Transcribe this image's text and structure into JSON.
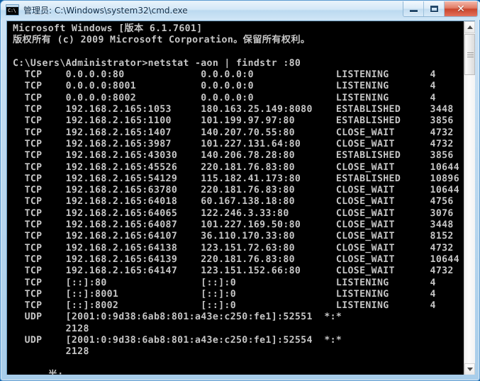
{
  "window": {
    "title": "管理员: C:\\Windows\\system32\\cmd.exe",
    "icon_label": "C:\\",
    "icon_name": "cmd-console-icon",
    "buttons": {
      "minimize": "minimize",
      "maximize": "maximize",
      "close": "✕"
    },
    "frame_color": "#a8cdea",
    "titlebar_color": "#d4e8f7",
    "close_color": "#c9452c"
  },
  "console": {
    "background_color": "#000000",
    "text_color": "#c6c6c6",
    "banner": [
      "Microsoft Windows [版本 6.1.7601]",
      "版权所有 (c) 2009 Microsoft Corporation。保留所有权利。"
    ],
    "prompt": "C:\\Users\\Administrator>",
    "command": "netstat -aon | findstr :80",
    "connections": [
      {
        "proto": "TCP",
        "local": "0.0.0.0:80",
        "foreign": "0.0.0.0:0",
        "state": "LISTENING",
        "pid": "4"
      },
      {
        "proto": "TCP",
        "local": "0.0.0.0:8001",
        "foreign": "0.0.0.0:0",
        "state": "LISTENING",
        "pid": "4"
      },
      {
        "proto": "TCP",
        "local": "0.0.0.0:8002",
        "foreign": "0.0.0.0:0",
        "state": "LISTENING",
        "pid": "4"
      },
      {
        "proto": "TCP",
        "local": "192.168.2.165:1053",
        "foreign": "180.163.25.149:8080",
        "state": "ESTABLISHED",
        "pid": "3448"
      },
      {
        "proto": "TCP",
        "local": "192.168.2.165:1100",
        "foreign": "101.199.97.97:80",
        "state": "ESTABLISHED",
        "pid": "3856"
      },
      {
        "proto": "TCP",
        "local": "192.168.2.165:1407",
        "foreign": "140.207.70.55:80",
        "state": "CLOSE_WAIT",
        "pid": "4732"
      },
      {
        "proto": "TCP",
        "local": "192.168.2.165:3987",
        "foreign": "101.227.131.64:80",
        "state": "CLOSE_WAIT",
        "pid": "4732"
      },
      {
        "proto": "TCP",
        "local": "192.168.2.165:43030",
        "foreign": "140.206.78.28:80",
        "state": "ESTABLISHED",
        "pid": "3856"
      },
      {
        "proto": "TCP",
        "local": "192.168.2.165:45526",
        "foreign": "220.181.76.83:80",
        "state": "CLOSE_WAIT",
        "pid": "10644"
      },
      {
        "proto": "TCP",
        "local": "192.168.2.165:54129",
        "foreign": "115.182.41.173:80",
        "state": "ESTABLISHED",
        "pid": "10896"
      },
      {
        "proto": "TCP",
        "local": "192.168.2.165:63780",
        "foreign": "220.181.76.83:80",
        "state": "CLOSE_WAIT",
        "pid": "10644"
      },
      {
        "proto": "TCP",
        "local": "192.168.2.165:64018",
        "foreign": "60.167.138.18:80",
        "state": "CLOSE_WAIT",
        "pid": "4756"
      },
      {
        "proto": "TCP",
        "local": "192.168.2.165:64065",
        "foreign": "122.246.3.33:80",
        "state": "CLOSE_WAIT",
        "pid": "3076"
      },
      {
        "proto": "TCP",
        "local": "192.168.2.165:64087",
        "foreign": "101.227.169.50:80",
        "state": "CLOSE_WAIT",
        "pid": "3448"
      },
      {
        "proto": "TCP",
        "local": "192.168.2.165:64107",
        "foreign": "36.110.170.33:80",
        "state": "CLOSE_WAIT",
        "pid": "8152"
      },
      {
        "proto": "TCP",
        "local": "192.168.2.165:64138",
        "foreign": "123.151.72.63:80",
        "state": "CLOSE_WAIT",
        "pid": "4732"
      },
      {
        "proto": "TCP",
        "local": "192.168.2.165:64139",
        "foreign": "220.181.76.83:80",
        "state": "CLOSE_WAIT",
        "pid": "10644"
      },
      {
        "proto": "TCP",
        "local": "192.168.2.165:64147",
        "foreign": "123.151.152.66:80",
        "state": "CLOSE_WAIT",
        "pid": "4732"
      },
      {
        "proto": "TCP",
        "local": "[::]:80",
        "foreign": "[::]:0",
        "state": "LISTENING",
        "pid": "4"
      },
      {
        "proto": "TCP",
        "local": "[::]:8001",
        "foreign": "[::]:0",
        "state": "LISTENING",
        "pid": "4"
      },
      {
        "proto": "TCP",
        "local": "[::]:8002",
        "foreign": "[::]:0",
        "state": "LISTENING",
        "pid": "4"
      }
    ],
    "udp_connections": [
      {
        "proto": "UDP",
        "local": "[2001:0:9d38:6ab8:801:a43e:c250:fe1]:52551",
        "foreign": "*:*",
        "pid": "2128"
      },
      {
        "proto": "UDP",
        "local": "[2001:0:9d38:6ab8:801:a43e:c250:fe1]:52554",
        "foreign": "*:*",
        "pid": "2128"
      }
    ],
    "trailing_line": "半:",
    "rendered_text": "Microsoft Windows [版本 6.1.7601]\n版权所有 (c) 2009 Microsoft Corporation。保留所有权利。\n\nC:\\Users\\Administrator>netstat -aon | findstr :80\n  TCP    0.0.0.0:80             0.0.0.0:0              LISTENING       4\n  TCP    0.0.0.0:8001           0.0.0.0:0              LISTENING       4\n  TCP    0.0.0.0:8002           0.0.0.0:0              LISTENING       4\n  TCP    192.168.2.165:1053     180.163.25.149:8080    ESTABLISHED     3448\n  TCP    192.168.2.165:1100     101.199.97.97:80       ESTABLISHED     3856\n  TCP    192.168.2.165:1407     140.207.70.55:80       CLOSE_WAIT      4732\n  TCP    192.168.2.165:3987     101.227.131.64:80      CLOSE_WAIT      4732\n  TCP    192.168.2.165:43030    140.206.78.28:80       ESTABLISHED     3856\n  TCP    192.168.2.165:45526    220.181.76.83:80       CLOSE_WAIT      10644\n  TCP    192.168.2.165:54129    115.182.41.173:80      ESTABLISHED     10896\n  TCP    192.168.2.165:63780    220.181.76.83:80       CLOSE_WAIT      10644\n  TCP    192.168.2.165:64018    60.167.138.18:80       CLOSE_WAIT      4756\n  TCP    192.168.2.165:64065    122.246.3.33:80        CLOSE_WAIT      3076\n  TCP    192.168.2.165:64087    101.227.169.50:80      CLOSE_WAIT      3448\n  TCP    192.168.2.165:64107    36.110.170.33:80       CLOSE_WAIT      8152\n  TCP    192.168.2.165:64138    123.151.72.63:80       CLOSE_WAIT      4732\n  TCP    192.168.2.165:64139    220.181.76.83:80       CLOSE_WAIT      10644\n  TCP    192.168.2.165:64147    123.151.152.66:80      CLOSE_WAIT      4732\n  TCP    [::]:80                [::]:0                 LISTENING       4\n  TCP    [::]:8001              [::]:0                 LISTENING       4\n  TCP    [::]:8002              [::]:0                 LISTENING       4\n  UDP    [2001:0:9d38:6ab8:801:a43e:c250:fe1]:52551  *:*\n         2128\n  UDP    [2001:0:9d38:6ab8:801:a43e:c250:fe1]:52554  *:*\n         2128\n\n      半:"
  },
  "scrollbar": {
    "up_arrow": "scroll-up",
    "down_arrow": "scroll-down",
    "thumb": "scroll-thumb"
  }
}
